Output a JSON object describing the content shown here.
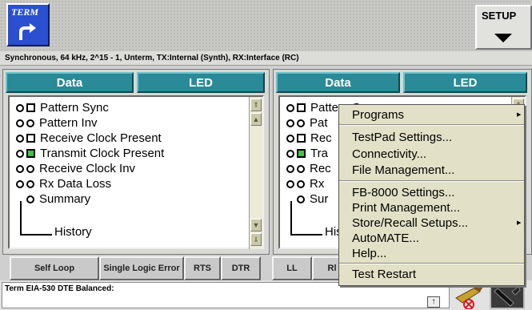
{
  "title_bar": {
    "term_label": "TERM",
    "setup_label": "SETUP"
  },
  "status_line": "Synchronous, 64 kHz, 2^15 - 1, Unterm, TX:Internal (Synth), RX:Interface (RC)",
  "left_panel": {
    "tabs": [
      "Data",
      "LED"
    ],
    "items": [
      "Pattern Sync",
      "Pattern Inv",
      "Receive Clock Present",
      "Transmit Clock Present",
      "Receive Clock Inv",
      "Rx Data Loss",
      "Summary"
    ],
    "history_label": "History"
  },
  "right_panel": {
    "tabs": [
      "Data",
      "LED"
    ],
    "items": [
      "Pattern Sync",
      "Pat",
      "Rec",
      "Tra",
      "Rec",
      "Rx",
      "Sur"
    ],
    "history_label": "His"
  },
  "buttons": {
    "self_loop": "Self Loop",
    "single_logic_error": "Single Logic Error",
    "rts": "RTS",
    "dtr": "DTR",
    "ll": "LL",
    "rl": "Rl"
  },
  "message": "Term EIA-530 DTE Balanced:",
  "message_arrow": "↑",
  "menu": {
    "items": [
      {
        "label": "Programs",
        "submenu": true
      },
      {
        "label": "TestPad Settings...",
        "submenu": false
      },
      {
        "label": "Connectivity...",
        "submenu": false
      },
      {
        "label": "File Management...",
        "submenu": false
      },
      {
        "label": "FB-8000 Settings...",
        "submenu": false
      },
      {
        "label": "Print Management...",
        "submenu": false
      },
      {
        "label": "Store/Recall Setups...",
        "submenu": true
      },
      {
        "label": "AutoMATE...",
        "submenu": false
      },
      {
        "label": "Help...",
        "submenu": false
      },
      {
        "label": "Test Restart",
        "submenu": false
      }
    ],
    "submenu_arrow": "▶"
  },
  "colors": {
    "tab": "#2a8a97",
    "term_button": "#2a4fd0",
    "led_on": "#44c244",
    "menu_bg": "#e2e0c6"
  },
  "icons": {
    "term": "return-arrow-icon",
    "setup": "dropdown-triangle-icon",
    "tool1": "brush-icon",
    "tool2": "pen-tool-icon"
  }
}
